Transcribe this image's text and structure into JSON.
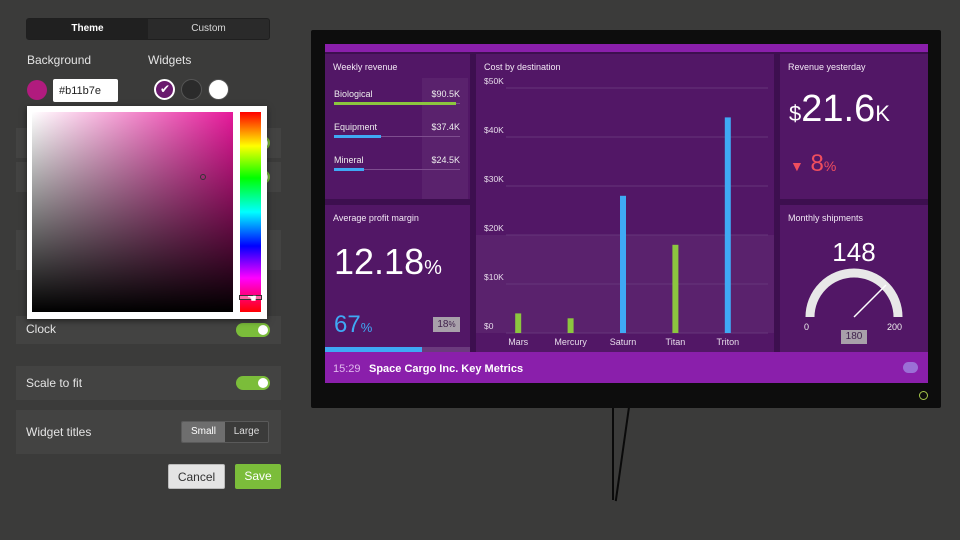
{
  "settings": {
    "tabs": [
      {
        "label": "Theme",
        "active": true
      },
      {
        "label": "Custom",
        "active": false
      }
    ],
    "background_label": "Background",
    "widgets_label": "Widgets",
    "background_color": "#b11b7e",
    "hex_value": "#b11b7e",
    "widget_swatches": [
      "#6a1a6e",
      "#2b2b2b",
      "#ffffff"
    ],
    "clock_label": "Clock",
    "scale_label": "Scale to fit",
    "widget_titles_label": "Widget titles",
    "widget_titles_options": [
      "Small",
      "Large"
    ],
    "widget_titles_selected": "Small",
    "cancel_label": "Cancel",
    "save_label": "Save"
  },
  "dashboard": {
    "weekly_revenue": {
      "title": "Weekly revenue",
      "rows": [
        {
          "name": "Biological",
          "value": "$90.5K",
          "bar_color": "#8cc63f",
          "fill": 0.97
        },
        {
          "name": "Equipment",
          "value": "$37.4K",
          "bar_color": "#3fa9f5",
          "fill": 0.37
        },
        {
          "name": "Mineral",
          "value": "$24.5K",
          "bar_color": "#3fa9f5",
          "fill": 0.24
        }
      ]
    },
    "profit_margin": {
      "title": "Average profit margin",
      "value": "12.18",
      "unit": "%",
      "secondary": "67",
      "secondary_unit": "%",
      "badge": "18",
      "badge_unit": "%",
      "progress": 0.67
    },
    "revenue_yesterday": {
      "title": "Revenue yesterday",
      "currency": "$",
      "value": "21.6",
      "suffix": "K",
      "change": "8",
      "change_unit": "%",
      "direction": "down"
    },
    "monthly_shipments": {
      "title": "Monthly shipments",
      "value": "148",
      "min": "0",
      "max": "200",
      "target": "180"
    },
    "footer": {
      "time": "15:29",
      "title": "Space Cargo Inc. Key Metrics"
    }
  },
  "chart_data": {
    "type": "bar",
    "title": "Cost by destination",
    "categories": [
      "Mars",
      "Mercury",
      "Saturn",
      "Titan",
      "Triton"
    ],
    "values": [
      4000,
      3000,
      28000,
      18000,
      44000
    ],
    "colors": [
      "#8cc63f",
      "#8cc63f",
      "#3fa9f5",
      "#8cc63f",
      "#3fa9f5"
    ],
    "ylim": [
      0,
      50000
    ],
    "yticks": [
      "$0",
      "$10K",
      "$20K",
      "$30K",
      "$40K",
      "$50K"
    ],
    "grid": true
  }
}
